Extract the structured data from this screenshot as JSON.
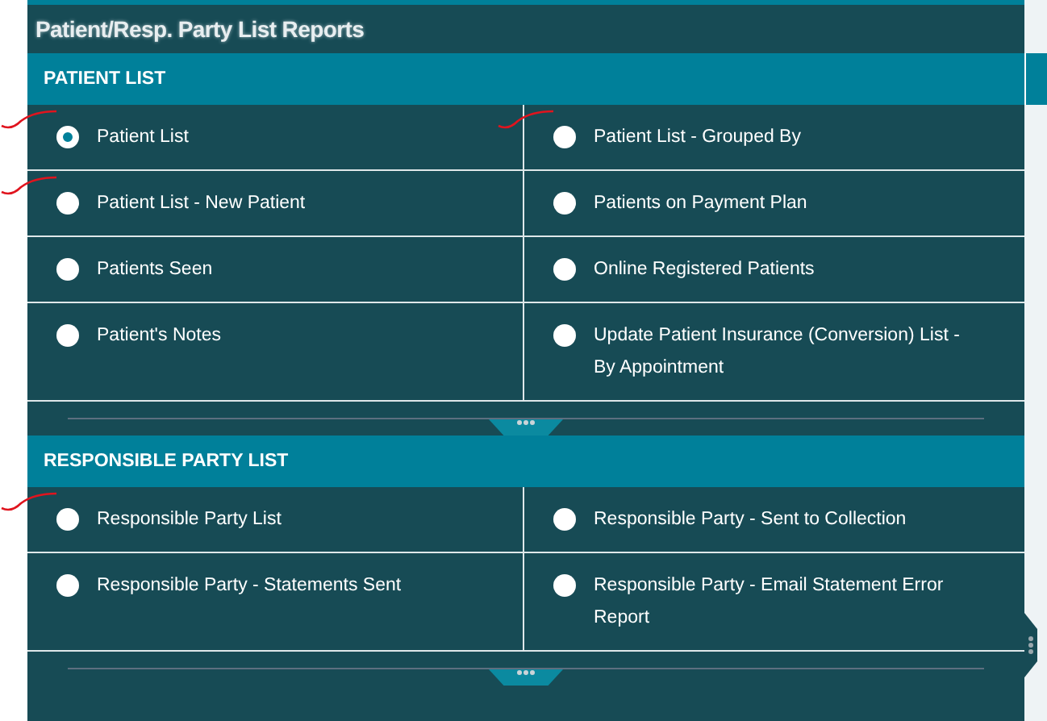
{
  "title": "Patient/Resp. Party List Reports",
  "sections": [
    {
      "heading": "PATIENT LIST",
      "options": [
        {
          "label": "Patient List",
          "selected": true,
          "annotated": true
        },
        {
          "label": "Patient List - Grouped By",
          "selected": false,
          "annotated": true
        },
        {
          "label": "Patient List - New Patient",
          "selected": false,
          "annotated": true
        },
        {
          "label": "Patients on Payment Plan",
          "selected": false,
          "annotated": false
        },
        {
          "label": "Patients Seen",
          "selected": false,
          "annotated": false
        },
        {
          "label": "Online Registered Patients",
          "selected": false,
          "annotated": false
        },
        {
          "label": "Patient's Notes",
          "selected": false,
          "annotated": false
        },
        {
          "label": "Update Patient Insurance (Conversion) List - By Appointment",
          "selected": false,
          "annotated": false
        }
      ]
    },
    {
      "heading": "RESPONSIBLE PARTY LIST",
      "options": [
        {
          "label": "Responsible Party List",
          "selected": false,
          "annotated": true
        },
        {
          "label": "Responsible Party - Sent to Collection",
          "selected": false,
          "annotated": false
        },
        {
          "label": "Responsible Party - Statements Sent",
          "selected": false,
          "annotated": false
        },
        {
          "label": "Responsible Party - Email Statement Error Report",
          "selected": false,
          "annotated": false
        }
      ]
    }
  ]
}
